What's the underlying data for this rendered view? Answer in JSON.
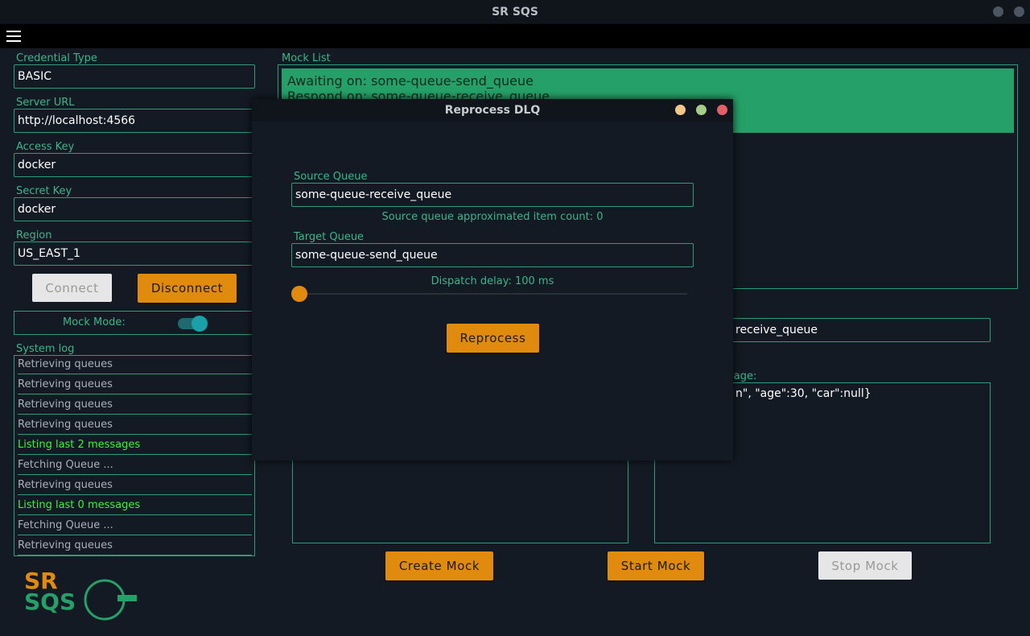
{
  "window": {
    "title": "SR SQS"
  },
  "config": {
    "credential_type": {
      "label": "Credential Type",
      "value": "BASIC"
    },
    "server_url": {
      "label": "Server URL",
      "value": "http://localhost:4566"
    },
    "access_key": {
      "label": "Access Key",
      "value": "docker"
    },
    "secret_key": {
      "label": "Secret Key",
      "value": "docker"
    },
    "region": {
      "label": "Region",
      "value": "US_EAST_1"
    },
    "connect_label": "Connect",
    "disconnect_label": "Disconnect",
    "mock_mode_label": "Mock Mode:",
    "mock_mode_on": true
  },
  "system_log": {
    "label": "System log",
    "entries": [
      {
        "text": "Retrieving queues",
        "highlight": false
      },
      {
        "text": "Retrieving queues",
        "highlight": false
      },
      {
        "text": "Retrieving queues",
        "highlight": false
      },
      {
        "text": "Retrieving queues",
        "highlight": false
      },
      {
        "text": "Listing last 2 messages",
        "highlight": true
      },
      {
        "text": "Fetching Queue ...",
        "highlight": false
      },
      {
        "text": "Retrieving queues",
        "highlight": false
      },
      {
        "text": "Listing last 0 messages",
        "highlight": true
      },
      {
        "text": "Fetching Queue ...",
        "highlight": false
      },
      {
        "text": "Retrieving queues",
        "highlight": false
      }
    ]
  },
  "mock_list": {
    "label": "Mock List",
    "item_line1": "Awaiting on: some-queue-send_queue",
    "item_line2": "Respond on: some-queue-receive_queue"
  },
  "mock_form": {
    "queue_label_partial": ":",
    "queue_value_partial": "receive_queue",
    "message_label_partial": "sage:",
    "message_value_partial": "n\", \"age\":30, \"car\":null}"
  },
  "actions": {
    "create_mock": "Create Mock",
    "start_mock": "Start Mock",
    "stop_mock": "Stop Mock"
  },
  "dialog": {
    "title": "Reprocess DLQ",
    "source_queue_label": "Source Queue",
    "source_queue_value": "some-queue-receive_queue",
    "source_count_text": "Source queue approximated item count: 0",
    "target_queue_label": "Target Queue",
    "target_queue_value": "some-queue-send_queue",
    "dispatch_delay_text": "Dispatch delay: 100 ms",
    "reprocess_label": "Reprocess"
  },
  "logo": {
    "line1": "SR",
    "line2": "SQS"
  },
  "colors": {
    "accent": "#e08a0e",
    "border": "#2e9c76",
    "label": "#3eb489",
    "mock_item_bg": "#26a069",
    "log_highlight": "#3ef23e"
  }
}
